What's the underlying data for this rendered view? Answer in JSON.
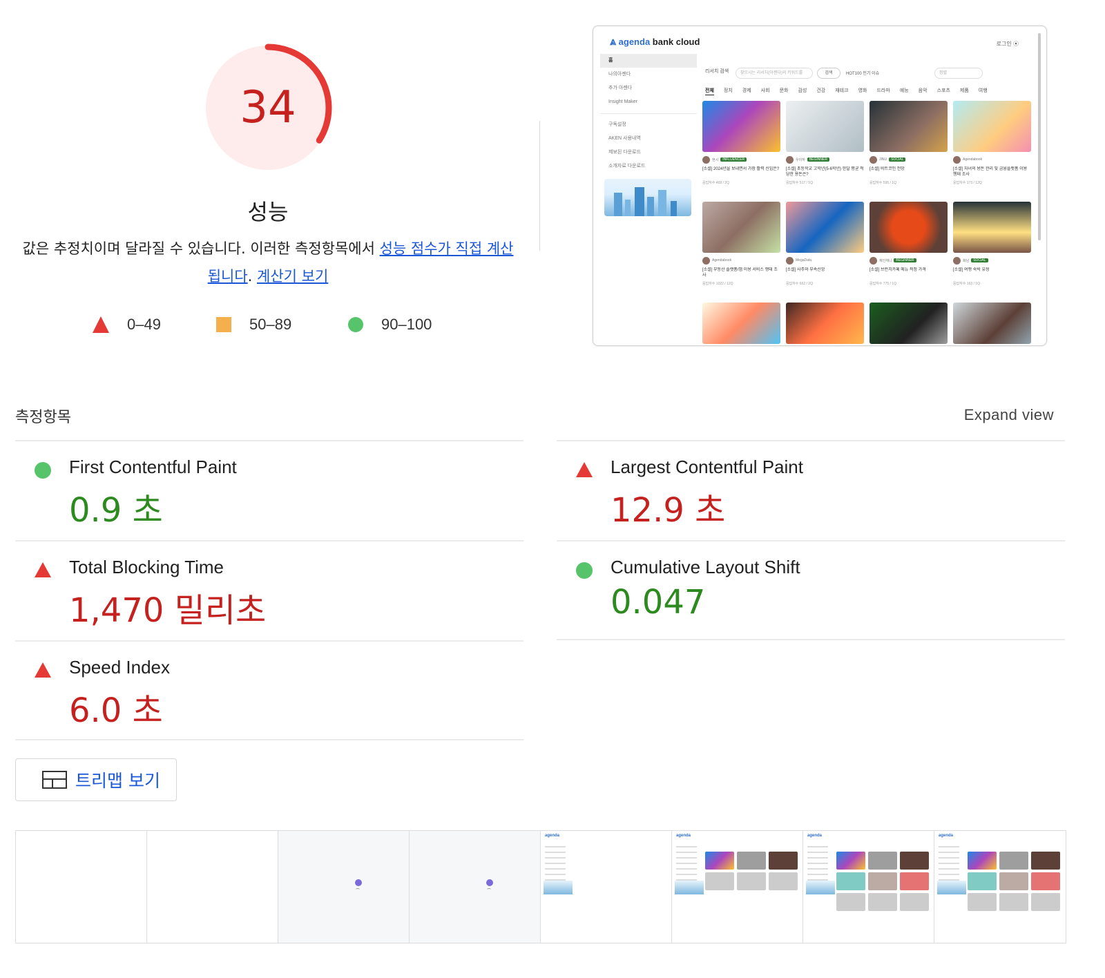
{
  "score": {
    "value": "34",
    "score_fraction": 0.34,
    "color": "#c5221f",
    "ring_color": "#e53935",
    "bg_color": "#fdeceb"
  },
  "title": "성능",
  "description": {
    "text_before": "값은 추정치이며 달라질 수 있습니다. 이러한 측정항목에서 ",
    "link1": "성능 점수가 직접 계산됩니다",
    "text_mid": ". ",
    "link2": "계산기 보기"
  },
  "legend": [
    {
      "label": "0–49",
      "shape": "triangle",
      "color": "#e53935"
    },
    {
      "label": "50–89",
      "shape": "square",
      "color": "#f4b04c"
    },
    {
      "label": "90–100",
      "shape": "circle",
      "color": "#57c46b"
    }
  ],
  "thumbnail": {
    "logo_brand": "agenda",
    "logo_rest": " bank cloud",
    "login": "로그인",
    "sidebar": [
      "홈",
      "나의아젠다",
      "추가 아젠다",
      "Insight Maker",
      "구독설정",
      "AKEN 사용내역",
      "제보된 다운로드",
      "소개자료 다운로드"
    ],
    "search_label": "리서치 검색",
    "search_placeholder": "찾으시는 리서치(아젠다)의 키워드를",
    "search_button": "검색",
    "chips": "HOT100  인기  이슈",
    "sort_placeholder": "정렬",
    "categories": [
      "전체",
      "정치",
      "경제",
      "사회",
      "문화",
      "감성",
      "건강",
      "재테크",
      "영화",
      "드라마",
      "예능",
      "음악",
      "스포츠",
      "제품",
      "여행"
    ],
    "cards": [
      {
        "author": "현시",
        "badge": "INFLUENCER",
        "title": "[소셜] 2024년을 보내면서 가장 활력 신입은?",
        "foot": "응답자수 469 / 2Q"
      },
      {
        "author": "우이자",
        "badge": "BEGINNER",
        "title": "[소셜] 초등학교 고학년(5-6학년) 한달 평균 적당한 용돈은?",
        "foot": "응답자수 517 / 1Q"
      },
      {
        "author": "JINU",
        "badge": "SOCIAL",
        "title": "[소셜] 비트코인 전망",
        "foot": "응답자수 595 / 1Q"
      },
      {
        "author": "Agendabook",
        "badge": "",
        "title": "[소셜] 자녀의 용돈 관리 및 금융플랫폼 이용 행태 조사",
        "foot": "응답자수 173 / 12Q"
      },
      {
        "author": "Agendabook",
        "badge": "",
        "title": "[소셜] 부동산 플랫폼/앱 이용 서비스 행태 조사",
        "foot": "응답자수 1022 / 12Q"
      },
      {
        "author": "MegaData",
        "badge": "",
        "title": "[소셜] 사주와 부속신앙",
        "foot": "응답자수 662 / 2Q"
      },
      {
        "author": "재인재니",
        "badge": "BEGINNER",
        "title": "[소셜] 브런치카페 메뉴 적정 가격",
        "foot": "응답자수 775 / 1Q"
      },
      {
        "author": "화남",
        "badge": "SOCIAL",
        "title": "[소셜] 여행 숙박 유형",
        "foot": "응답자수 163 / 1Q"
      }
    ]
  },
  "metrics_label": "측정항목",
  "expand_view": "Expand view",
  "metrics": {
    "fcp": {
      "name": "First Contentful Paint",
      "value": "0.9 초",
      "status": "pass"
    },
    "lcp": {
      "name": "Largest Contentful Paint",
      "value": "12.9 초",
      "status": "fail"
    },
    "tbt": {
      "name": "Total Blocking Time",
      "value": "1,470 밀리초",
      "status": "fail"
    },
    "cls": {
      "name": "Cumulative Layout Shift",
      "value": "0.047",
      "status": "pass"
    },
    "si": {
      "name": "Speed Index",
      "value": "6.0 초",
      "status": "fail"
    }
  },
  "treemap_button": "트리맵 보기",
  "filmstrip": {
    "frames": 8
  }
}
